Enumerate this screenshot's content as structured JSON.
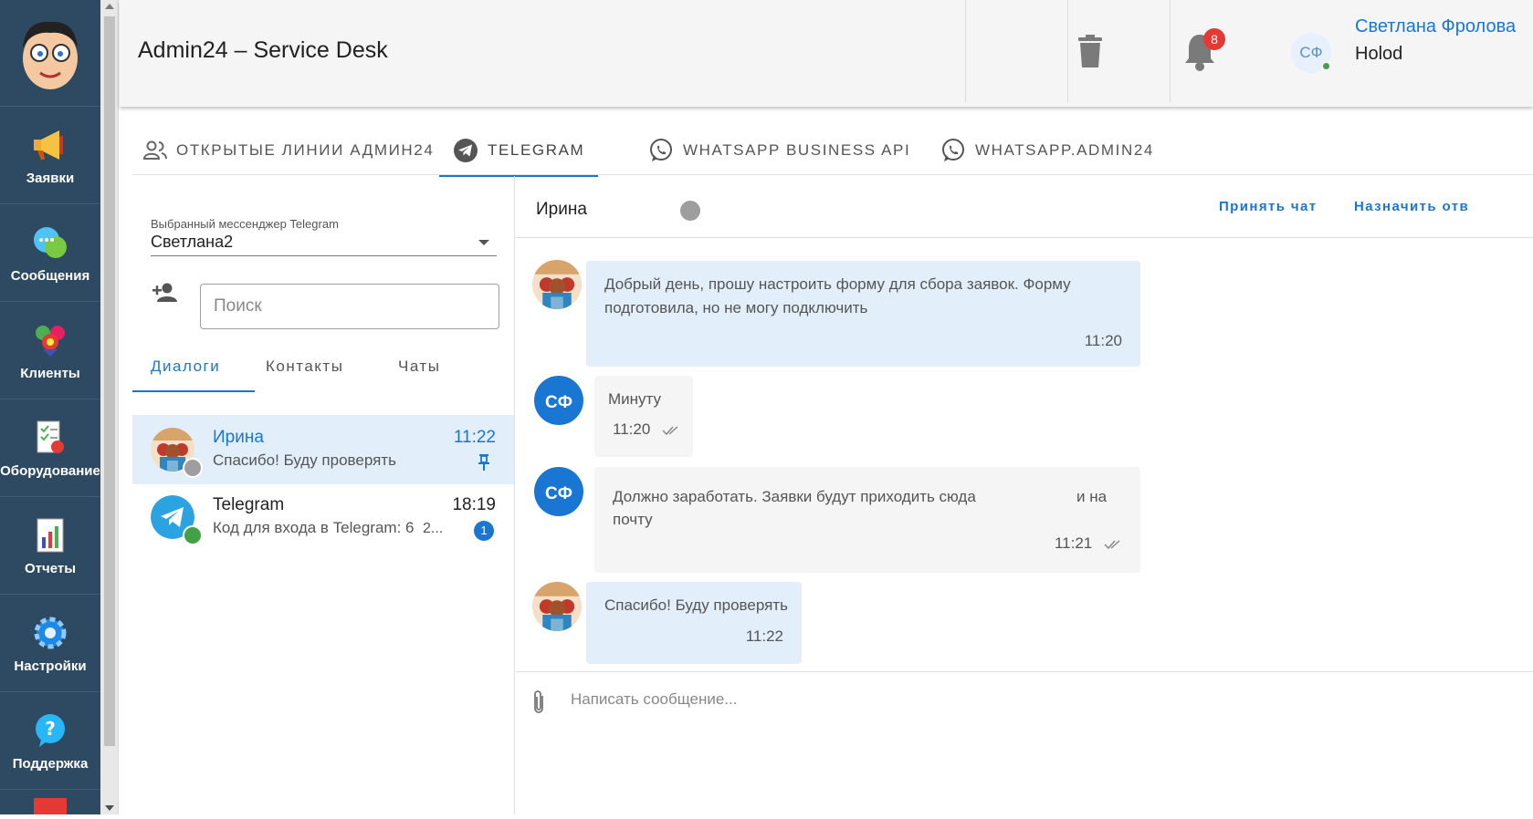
{
  "header": {
    "title": "Admin24 – Service Desk",
    "notifications_count": "8",
    "user_initials": "СФ",
    "user_name": "Светлана Фролова",
    "user_org": "Holod"
  },
  "sidebar": {
    "items": [
      {
        "label": "Заявки",
        "icon": "megaphone-icon"
      },
      {
        "label": "Сообщения",
        "icon": "chat-bubbles-icon"
      },
      {
        "label": "Клиенты",
        "icon": "clients-icon"
      },
      {
        "label": "Оборудование",
        "icon": "equipment-checklist-icon"
      },
      {
        "label": "Отчеты",
        "icon": "report-chart-icon"
      },
      {
        "label": "Настройки",
        "icon": "gear-icon"
      },
      {
        "label": "Поддержка",
        "icon": "help-question-icon"
      }
    ]
  },
  "tabs": [
    {
      "label": "Открытые линии Админ24",
      "icon": "people-icon"
    },
    {
      "label": "Telegram",
      "icon": "telegram-icon"
    },
    {
      "label": "WhatsApp Business API",
      "icon": "whatsapp-icon"
    },
    {
      "label": "Whatsapp.admin24",
      "icon": "whatsapp-icon"
    }
  ],
  "left": {
    "messenger_label": "Выбранный мессенджер Telegram",
    "messenger_value": "Светлана2",
    "search_placeholder": "Поиск",
    "subtabs": [
      "Диалоги",
      "Контакты",
      "Чаты"
    ],
    "conversations": [
      {
        "name": "Ирина",
        "last": "Спасибо! Буду проверять",
        "time": "11:22"
      },
      {
        "name": "Telegram",
        "last": "Код для входа в Telegram: 6",
        "trail": "2...",
        "time": "18:19",
        "unread": "1"
      }
    ]
  },
  "chat": {
    "contact_name": "Ирина",
    "accept_label": "Принять чат",
    "assign_label": "Назначить отв",
    "messages": [
      {
        "text1": "Добрый день, прошу настроить форму для сбора заявок. Форму",
        "text2": "подготовила, но не могу подключить",
        "time": "11:20"
      },
      {
        "initials": "СФ",
        "text": "Минуту",
        "time": "11:20"
      },
      {
        "initials": "СФ",
        "text1": "Должно заработать. Заявки будут приходить сюда",
        "text1b": "и на",
        "text2": "почту",
        "time": "11:21"
      },
      {
        "text": "Спасибо! Буду проверять",
        "time": "11:22"
      }
    ],
    "composer_placeholder": "Написать сообщение..."
  },
  "colors": {
    "accent": "#1976d2",
    "sidebar": "#2e4a62",
    "online": "#43a047",
    "offline": "#9e9e9e",
    "badge": "#e53935"
  }
}
